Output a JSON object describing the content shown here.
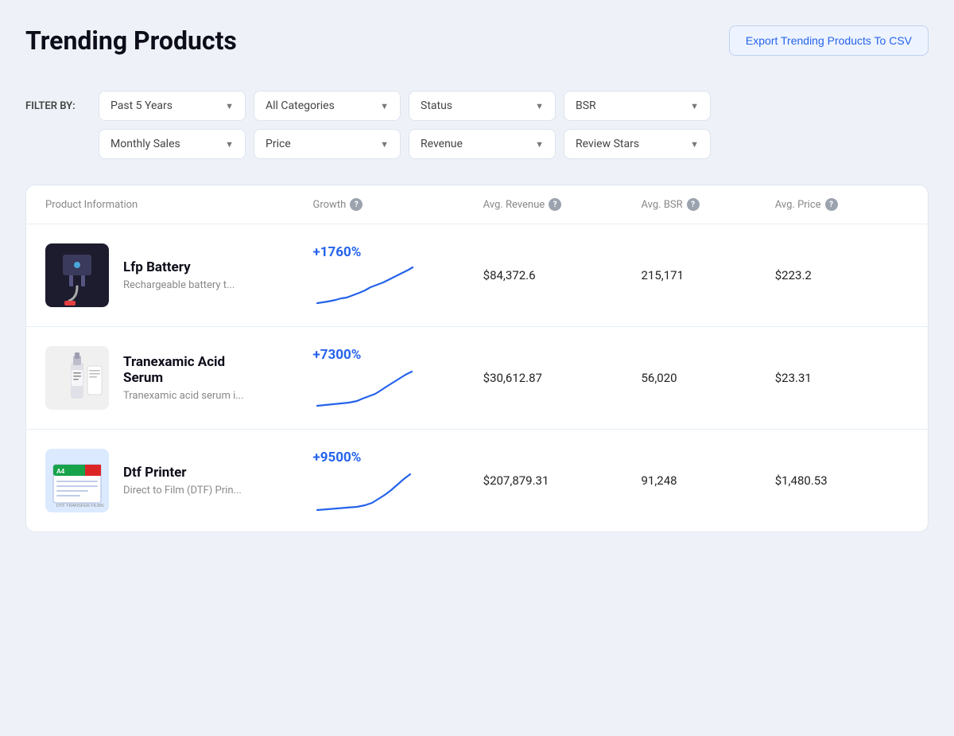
{
  "header": {
    "title": "Trending Products",
    "export_button": "Export Trending Products To CSV"
  },
  "filters": {
    "label": "FILTER BY:",
    "row1": [
      {
        "id": "time",
        "label": "Past 5 Years"
      },
      {
        "id": "categories",
        "label": "All Categories"
      },
      {
        "id": "status",
        "label": "Status"
      },
      {
        "id": "bsr",
        "label": "BSR"
      }
    ],
    "row2": [
      {
        "id": "monthly_sales",
        "label": "Monthly Sales"
      },
      {
        "id": "price",
        "label": "Price"
      },
      {
        "id": "revenue",
        "label": "Revenue"
      },
      {
        "id": "review_stars",
        "label": "Review Stars"
      }
    ]
  },
  "table": {
    "columns": [
      {
        "id": "product",
        "label": "Product Information",
        "has_help": false
      },
      {
        "id": "growth",
        "label": "Growth",
        "has_help": true
      },
      {
        "id": "avg_revenue",
        "label": "Avg. Revenue",
        "has_help": true
      },
      {
        "id": "avg_bsr",
        "label": "Avg. BSR",
        "has_help": true
      },
      {
        "id": "avg_price",
        "label": "Avg. Price",
        "has_help": true
      }
    ],
    "rows": [
      {
        "id": "lfp-battery",
        "name": "Lfp Battery",
        "description": "Rechargeable battery t...",
        "growth": "+1760%",
        "avg_revenue": "$84,372.6",
        "avg_bsr": "215,171",
        "avg_price": "$223.2",
        "image_type": "battery"
      },
      {
        "id": "tranexamic-acid-serum",
        "name": "Tranexamic Acid Serum",
        "description": "Tranexamic acid serum i...",
        "growth": "+7300%",
        "avg_revenue": "$30,612.87",
        "avg_bsr": "56,020",
        "avg_price": "$23.31",
        "image_type": "serum"
      },
      {
        "id": "dtf-printer",
        "name": "Dtf Printer",
        "description": "Direct to Film (DTF) Prin...",
        "growth": "+9500%",
        "avg_revenue": "$207,879.31",
        "avg_bsr": "91,248",
        "avg_price": "$1,480.53",
        "image_type": "dtf"
      }
    ]
  }
}
